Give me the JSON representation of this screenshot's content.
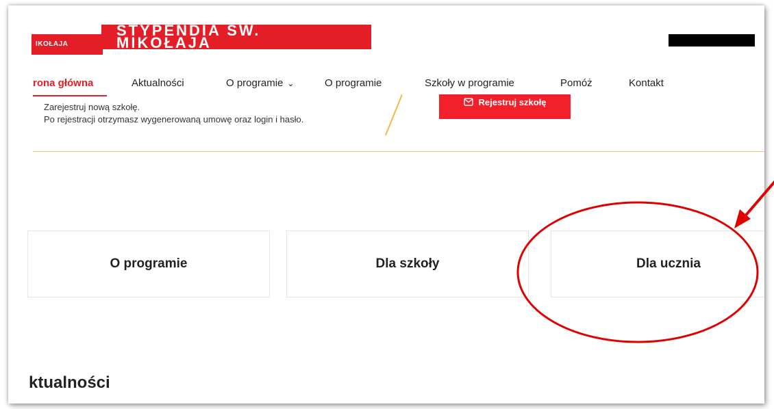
{
  "header": {
    "logo_small": "IKOŁAJA",
    "logo_big": "STYPENDIA ŚW. MIKOŁAJA"
  },
  "nav": {
    "items": [
      {
        "label": "rona główna",
        "active": true
      },
      {
        "label": "Aktualności"
      },
      {
        "label": "O programie"
      },
      {
        "label": "O programie"
      },
      {
        "label": "Szkoły w programie"
      },
      {
        "label": "Pomóż"
      },
      {
        "label": "Kontakt"
      }
    ]
  },
  "registration": {
    "line1": "Zarejestruj nową szkołę.",
    "line2": "Po rejestracji otrzymasz wygenerowaną umowę oraz login i hasło.",
    "button_label": "Rejestruj szkołę"
  },
  "cards": [
    {
      "label": "O programie"
    },
    {
      "label": "Dla szkoły"
    },
    {
      "label": "Dla ucznia"
    }
  ],
  "section": {
    "title": "ktualności"
  },
  "colors": {
    "accent": "#e41e26",
    "divider": "#f3c76a",
    "annotation": "#e00000"
  },
  "icons": {
    "chevron": "chevron-down-icon",
    "button_icon": "envelope-icon"
  }
}
